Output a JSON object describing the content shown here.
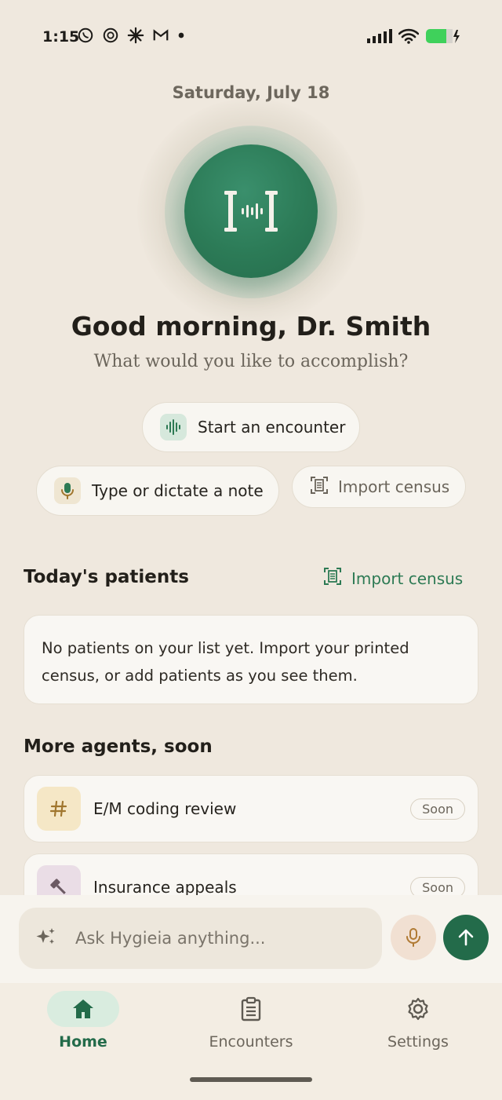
{
  "status_bar": {
    "time": "1:15",
    "left_icons": [
      "whatsapp-icon",
      "threads-icon",
      "claude-icon",
      "gmail-icon",
      "dot-icon"
    ],
    "right_icons": [
      "signal-icon",
      "wifi-icon",
      "battery-charging-icon"
    ]
  },
  "header": {
    "date": "Saturday, July 18",
    "greeting": "Good morning, Dr. Smith",
    "subtitle": "What would you like to accomplish?"
  },
  "actions": {
    "start_encounter": "Start an encounter",
    "dictate_note": "Type or dictate a note",
    "import_census": "Import census"
  },
  "patients": {
    "title": "Today's patients",
    "import_link": "Import census",
    "empty_message": "No patients on your list yet. Import your printed census, or add patients as you see them."
  },
  "agents": {
    "title": "More agents, soon",
    "items": [
      {
        "label": "E/M coding review",
        "badge": "Soon",
        "icon": "hash-icon"
      },
      {
        "label": "Insurance appeals",
        "badge": "Soon",
        "icon": "gavel-icon"
      }
    ]
  },
  "composer": {
    "placeholder": "Ask Hygieia anything..."
  },
  "tabs": [
    {
      "label": "Home",
      "icon": "home-icon",
      "active": true
    },
    {
      "label": "Encounters",
      "icon": "clipboard-icon",
      "active": false
    },
    {
      "label": "Settings",
      "icon": "gear-icon",
      "active": false
    }
  ],
  "colors": {
    "accent": "#236b4a",
    "background": "#efe8de",
    "card": "#f9f7f3"
  }
}
